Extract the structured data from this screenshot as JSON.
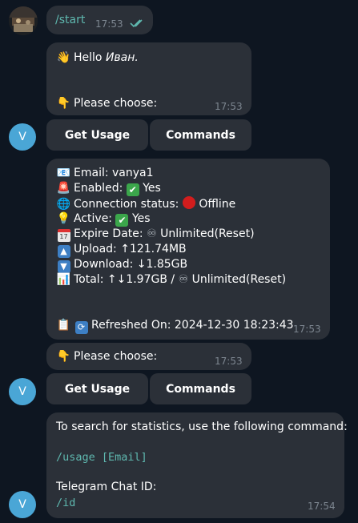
{
  "user_message": {
    "text": "/start",
    "time": "17:53",
    "status_icon": "double-check-icon"
  },
  "bot_avatar_letter": "V",
  "message1": {
    "greeting_prefix": "Hello ",
    "greeting_name": "Иван.",
    "prompt": "Please choose:",
    "time": "17:53",
    "buttons": [
      "Get Usage",
      "Commands"
    ]
  },
  "message2": {
    "email": "Email: vanya1",
    "enabled_label": "Enabled:",
    "enabled_value": "Yes",
    "connection_label": "Connection status:",
    "connection_value": "Offline",
    "active_label": "Active:",
    "active_value": "Yes",
    "expire_label": "Expire Date:",
    "expire_value": "Unlimited(Reset)",
    "upload": "Upload: ↑121.74MB",
    "download": "Download: ↓1.85GB",
    "total_label": "Total: ↑↓1.97GB /",
    "total_value": "Unlimited(Reset)",
    "refreshed": "Refreshed On: 2024-12-30 18:23:43",
    "time": "17:53",
    "calendar_day": "17"
  },
  "message3": {
    "prompt": "Please choose:",
    "time": "17:53",
    "buttons": [
      "Get Usage",
      "Commands"
    ]
  },
  "message4": {
    "line1": "To search for statistics, use the following command:",
    "command1": "/usage [Email]",
    "line2": "Telegram Chat ID:",
    "command2": "/id",
    "time": "17:54"
  }
}
